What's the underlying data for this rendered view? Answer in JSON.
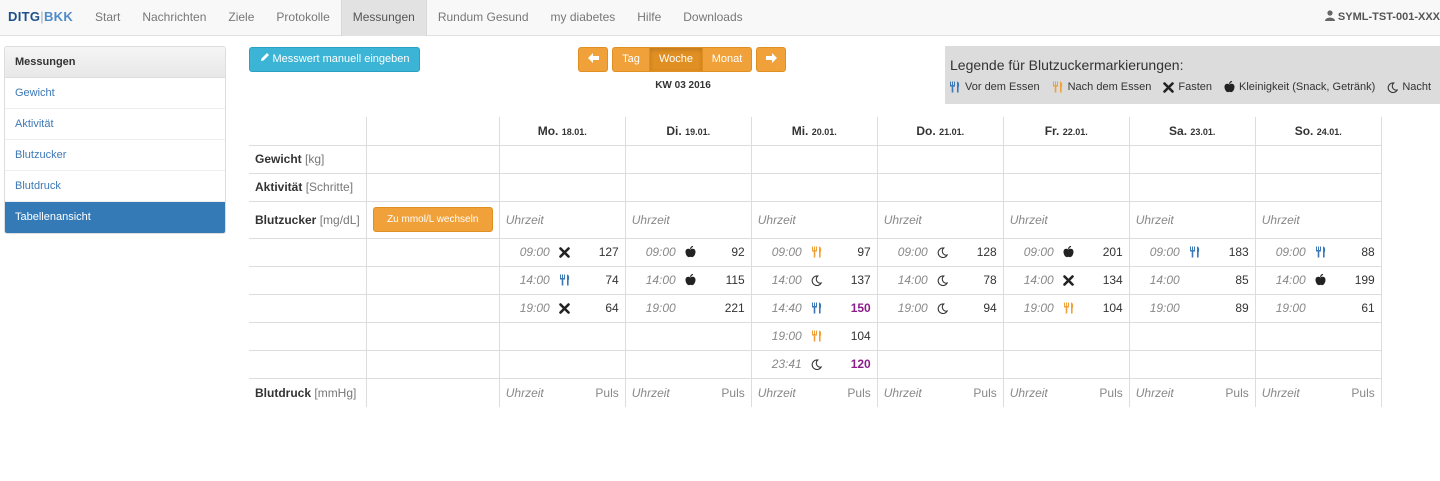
{
  "brand": {
    "left": "DITG",
    "sep": "|",
    "right": "BKK"
  },
  "nav": [
    {
      "label": "Start",
      "active": false
    },
    {
      "label": "Nachrichten",
      "active": false
    },
    {
      "label": "Ziele",
      "active": false
    },
    {
      "label": "Protokolle",
      "active": false
    },
    {
      "label": "Messungen",
      "active": true
    },
    {
      "label": "Rundum Gesund",
      "active": false
    },
    {
      "label": "my diabetes",
      "active": false
    },
    {
      "label": "Hilfe",
      "active": false
    },
    {
      "label": "Downloads",
      "active": false
    }
  ],
  "user": "SYML-TST-001-XXX",
  "sidebar": {
    "title": "Messungen",
    "items": [
      {
        "label": "Gewicht",
        "active": false
      },
      {
        "label": "Aktivität",
        "active": false
      },
      {
        "label": "Blutzucker",
        "active": false
      },
      {
        "label": "Blutdruck",
        "active": false
      },
      {
        "label": "Tabellenansicht",
        "active": true
      }
    ]
  },
  "toolbar": {
    "manual_entry": "Messwert manuell eingeben",
    "tag": "Tag",
    "woche": "Woche",
    "monat": "Monat",
    "active_view": "Woche",
    "week_label": "KW 03 2016"
  },
  "legend": {
    "title": "Legende für Blutzuckermarkierungen:",
    "items": [
      {
        "icon": "fork-knife-blue-icon",
        "label": "Vor dem Essen"
      },
      {
        "icon": "fork-knife-orange-icon",
        "label": "Nach dem Essen"
      },
      {
        "icon": "cross-icon",
        "label": "Fasten"
      },
      {
        "icon": "apple-icon",
        "label": "Kleinigkeit (Snack, Getränk)"
      },
      {
        "icon": "moon-icon",
        "label": "Nacht"
      }
    ]
  },
  "colors": {
    "blue": "#3c78b5",
    "orange": "#f0a13a",
    "highlight": "#8a1f8a"
  },
  "table": {
    "days": [
      {
        "name": "Mo.",
        "date": "18.01."
      },
      {
        "name": "Di.",
        "date": "19.01."
      },
      {
        "name": "Mi.",
        "date": "20.01."
      },
      {
        "name": "Do.",
        "date": "21.01."
      },
      {
        "name": "Fr.",
        "date": "22.01."
      },
      {
        "name": "Sa.",
        "date": "23.01."
      },
      {
        "name": "So.",
        "date": "24.01."
      }
    ],
    "rows": {
      "gewicht": {
        "label": "Gewicht",
        "unit": "[kg]"
      },
      "aktivitaet": {
        "label": "Aktivität",
        "unit": "[Schritte]"
      },
      "blutzucker": {
        "label": "Blutzucker",
        "unit": "[mg/dL]",
        "button": "Zu mmol/L wechseln"
      },
      "blutdruck": {
        "label": "Blutdruck",
        "unit": "[mmHg]"
      }
    },
    "uhrzeit": "Uhrzeit",
    "puls": "Puls",
    "glucose": [
      [
        {
          "time": "09:00",
          "icon": "cross-icon",
          "value": "127"
        },
        {
          "time": "14:00",
          "icon": "fork-knife-blue-icon",
          "value": "74"
        },
        {
          "time": "19:00",
          "icon": "cross-icon",
          "value": "64"
        }
      ],
      [
        {
          "time": "09:00",
          "icon": "apple-icon",
          "value": "92"
        },
        {
          "time": "14:00",
          "icon": "apple-icon",
          "value": "115"
        },
        {
          "time": "19:00",
          "icon": "",
          "value": "221"
        }
      ],
      [
        {
          "time": "09:00",
          "icon": "fork-knife-orange-icon",
          "value": "97"
        },
        {
          "time": "14:00",
          "icon": "moon-icon",
          "value": "137"
        },
        {
          "time": "14:40",
          "icon": "fork-knife-blue-icon",
          "value": "150",
          "hi": true
        },
        {
          "time": "19:00",
          "icon": "fork-knife-orange-icon",
          "value": "104"
        },
        {
          "time": "23:41",
          "icon": "moon-icon",
          "value": "120",
          "hi": true
        }
      ],
      [
        {
          "time": "09:00",
          "icon": "moon-icon",
          "value": "128"
        },
        {
          "time": "14:00",
          "icon": "moon-icon",
          "value": "78"
        },
        {
          "time": "19:00",
          "icon": "moon-icon",
          "value": "94"
        }
      ],
      [
        {
          "time": "09:00",
          "icon": "apple-icon",
          "value": "201"
        },
        {
          "time": "14:00",
          "icon": "cross-icon",
          "value": "134"
        },
        {
          "time": "19:00",
          "icon": "fork-knife-orange-icon",
          "value": "104"
        }
      ],
      [
        {
          "time": "09:00",
          "icon": "fork-knife-blue-icon",
          "value": "183"
        },
        {
          "time": "14:00",
          "icon": "",
          "value": "85"
        },
        {
          "time": "19:00",
          "icon": "",
          "value": "89"
        }
      ],
      [
        {
          "time": "09:00",
          "icon": "fork-knife-blue-icon",
          "value": "88"
        },
        {
          "time": "14:00",
          "icon": "apple-icon",
          "value": "199"
        },
        {
          "time": "19:00",
          "icon": "",
          "value": "61"
        }
      ]
    ]
  }
}
